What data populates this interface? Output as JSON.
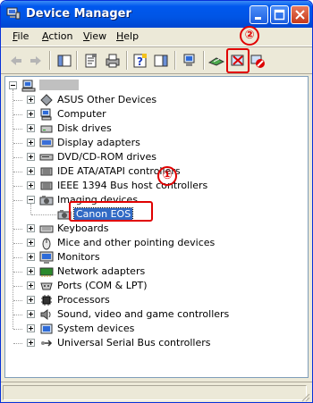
{
  "window": {
    "title": "Device Manager"
  },
  "menu": [
    {
      "first": "F",
      "rest": "ile"
    },
    {
      "first": "A",
      "rest": "ction"
    },
    {
      "first": "V",
      "rest": "iew"
    },
    {
      "first": "H",
      "rest": "elp"
    }
  ],
  "tree": {
    "root_label": "",
    "items": [
      {
        "label": "ASUS Other Devices",
        "icon": "device-icon"
      },
      {
        "label": "Computer",
        "icon": "computer-icon"
      },
      {
        "label": "Disk drives",
        "icon": "disk-icon"
      },
      {
        "label": "Display adapters",
        "icon": "display-icon"
      },
      {
        "label": "DVD/CD-ROM drives",
        "icon": "cdrom-icon"
      },
      {
        "label": "IDE ATA/ATAPI controllers",
        "icon": "ide-icon"
      },
      {
        "label": "IEEE 1394 Bus host controllers",
        "icon": "ieee1394-icon"
      },
      {
        "label": "Imaging devices",
        "icon": "camera-icon"
      },
      {
        "label": "Canon EOS",
        "icon": "camera-icon",
        "child": true,
        "selected": true
      },
      {
        "label": "Keyboards",
        "icon": "keyboard-icon"
      },
      {
        "label": "Mice and other pointing devices",
        "icon": "mouse-icon"
      },
      {
        "label": "Monitors",
        "icon": "monitor-icon"
      },
      {
        "label": "Network adapters",
        "icon": "network-icon"
      },
      {
        "label": "Ports (COM & LPT)",
        "icon": "port-icon"
      },
      {
        "label": "Processors",
        "icon": "processor-icon"
      },
      {
        "label": "Sound, video and game controllers",
        "icon": "sound-icon"
      },
      {
        "label": "System devices",
        "icon": "system-icon"
      },
      {
        "label": "Universal Serial Bus controllers",
        "icon": "usb-icon"
      }
    ]
  },
  "callouts": {
    "one": "①",
    "two": "②"
  },
  "colors": {
    "selection": "#316ac5",
    "callout": "#e00000",
    "titlebar": "#0055e5"
  }
}
